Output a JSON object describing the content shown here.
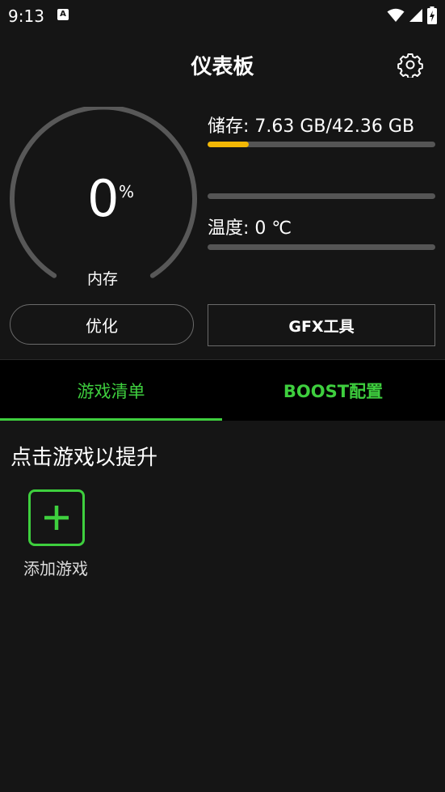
{
  "status_bar": {
    "time": "9:13",
    "notification_glyph": "A",
    "icons": [
      "wifi-icon",
      "cell-signal-icon",
      "battery-charging-icon"
    ]
  },
  "header": {
    "title": "仪表板",
    "settings_icon": "gear-icon"
  },
  "memory_gauge": {
    "value": "0",
    "unit": "%",
    "label": "内存"
  },
  "storage": {
    "label": "储存: 7.63 GB/42.36 GB",
    "used_fraction": 0.18
  },
  "middle_bar": {
    "fraction": 0
  },
  "temperature": {
    "label": "温度: 0 ℃",
    "fraction": 0
  },
  "actions": {
    "optimize_label": "优化",
    "gfx_label": "GFX工具"
  },
  "tabs": [
    {
      "label": "游戏清单",
      "active": true
    },
    {
      "label": "BOOST配置",
      "active": false
    }
  ],
  "content": {
    "title": "点击游戏以提升",
    "add_game_label": "添加游戏",
    "add_icon": "plus-icon"
  },
  "colors": {
    "background": "#151515",
    "accent_green": "#3ecf3e",
    "storage_fill": "#f2b705",
    "track": "#555555"
  }
}
